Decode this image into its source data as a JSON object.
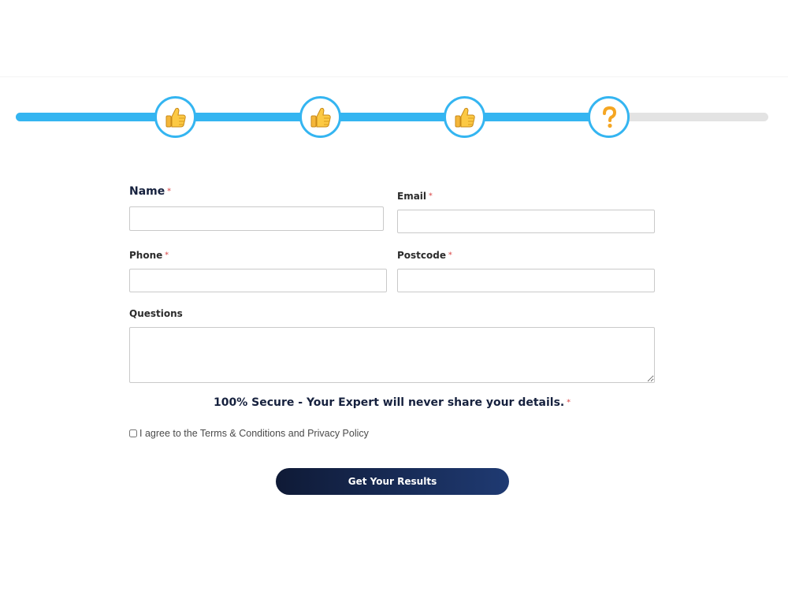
{
  "progress": {
    "fraction": 0.79,
    "steps": [
      {
        "status": "done",
        "icon": "thumbs-up-icon"
      },
      {
        "status": "done",
        "icon": "thumbs-up-icon"
      },
      {
        "status": "done",
        "icon": "thumbs-up-icon"
      },
      {
        "status": "current",
        "icon": "question-mark-icon"
      }
    ],
    "accent_color": "#34b5f1",
    "track_color": "#e3e3e3"
  },
  "form": {
    "name_label": "Name",
    "email_label": "Email",
    "phone_label": "Phone",
    "postcode_label": "Postcode",
    "questions_label": "Questions",
    "required_marker": "*",
    "name_value": "",
    "email_value": "",
    "phone_value": "",
    "postcode_value": "",
    "questions_value": ""
  },
  "secure_text": "100% Secure - Your Expert will never share your details.",
  "agree_text": "I agree to the Terms & Conditions and Privacy Policy",
  "submit_label": "Get Your Results",
  "colors": {
    "button_start": "#0f1a36",
    "button_end": "#1f3a72",
    "required": "#e06666"
  }
}
